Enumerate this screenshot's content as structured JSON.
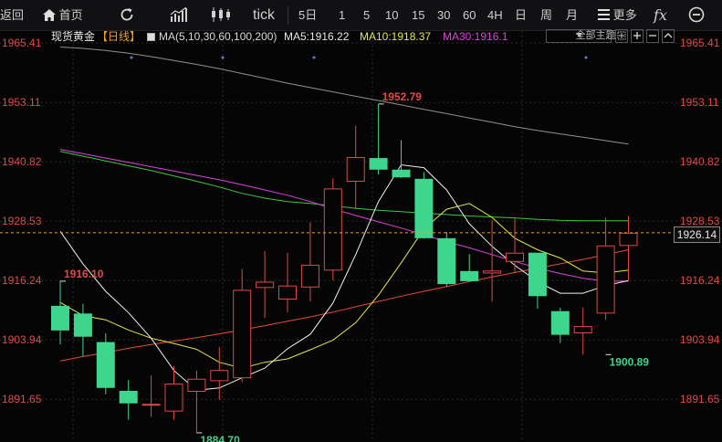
{
  "toolbar": {
    "back_label": "返回",
    "home_label": "首页",
    "refresh_icon": "refresh-icon",
    "indicator_icon": "indicator-icon",
    "candle_icon": "candlestick-icon",
    "tick_label": "tick",
    "periods": [
      "5日",
      "1",
      "5",
      "10",
      "15",
      "30",
      "60",
      "4H",
      "日",
      "周",
      "月"
    ],
    "more_label": "更多",
    "fx_label": "fx",
    "zoom_icon": "zoom-out-icon"
  },
  "infobar": {
    "symbol": "现货黄金",
    "period": "【日线】",
    "ma_params": "MA(5,10,30,60,100,200)",
    "ma5": "MA5:1916.22",
    "ma10": "MA10:1918.37",
    "ma30": "MA30:1916.1",
    "topic_label": "全部主题",
    "dropdown_icon": "chevron-down-icon",
    "tool_icons": [
      "crosshair-icon",
      "add-icon",
      "minus-icon",
      "collapse-icon"
    ]
  },
  "colors": {
    "up": "#e04848",
    "down": "#3dd68c",
    "ma5": "#f0f0f0",
    "ma10": "#e6e64a",
    "ma30": "#e040e0",
    "ma60": "#3cc83c",
    "ma100": "#e84a3a",
    "ma200": "#909090",
    "current": "#f0a020",
    "grid": "#2a2a2a"
  },
  "chart_data": {
    "type": "candlestick",
    "yticks": [
      "1965.41",
      "1953.11",
      "1940.82",
      "1928.53",
      "1916.24",
      "1903.94",
      "1891.65"
    ],
    "ylim": [
      1882.8,
      1967.9
    ],
    "current_price": "1926.14",
    "annotations": [
      {
        "text": "1916.10",
        "candle": 0,
        "value": 1916.1,
        "side": "high"
      },
      {
        "text": "1884.70",
        "candle": 6,
        "value": 1884.7,
        "side": "low"
      },
      {
        "text": "1952.79",
        "candle": 14,
        "value": 1952.79,
        "side": "high"
      },
      {
        "text": "1900.89",
        "candle": 24,
        "value": 1900.89,
        "side": "low"
      }
    ],
    "candles": [
      {
        "open": 1911.0,
        "high": 1916.1,
        "low": 1903.0,
        "close": 1905.9
      },
      {
        "open": 1909.4,
        "high": 1911.4,
        "low": 1900.5,
        "close": 1904.6
      },
      {
        "open": 1903.5,
        "high": 1905.3,
        "low": 1892.7,
        "close": 1894.0
      },
      {
        "open": 1893.4,
        "high": 1895.6,
        "low": 1887.4,
        "close": 1890.8
      },
      {
        "open": 1890.5,
        "high": 1896.6,
        "low": 1888.0,
        "close": 1890.7
      },
      {
        "open": 1889.1,
        "high": 1898.5,
        "low": 1887.4,
        "close": 1894.9
      },
      {
        "open": 1893.2,
        "high": 1897.6,
        "low": 1884.7,
        "close": 1895.9
      },
      {
        "open": 1895.4,
        "high": 1902.5,
        "low": 1891.5,
        "close": 1897.7
      },
      {
        "open": 1896.0,
        "high": 1918.6,
        "low": 1895.2,
        "close": 1914.3
      },
      {
        "open": 1914.7,
        "high": 1922.3,
        "low": 1908.5,
        "close": 1916.0
      },
      {
        "open": 1912.3,
        "high": 1922.0,
        "low": 1909.6,
        "close": 1915.2
      },
      {
        "open": 1914.8,
        "high": 1928.3,
        "low": 1911.9,
        "close": 1919.5
      },
      {
        "open": 1918.3,
        "high": 1937.4,
        "low": 1916.3,
        "close": 1935.3
      },
      {
        "open": 1936.7,
        "high": 1948.3,
        "low": 1931.0,
        "close": 1941.8
      },
      {
        "open": 1941.6,
        "high": 1952.79,
        "low": 1938.2,
        "close": 1939.2
      },
      {
        "open": 1939.2,
        "high": 1945.3,
        "low": 1937.5,
        "close": 1937.6
      },
      {
        "open": 1937.3,
        "high": 1938.7,
        "low": 1924.9,
        "close": 1925.0
      },
      {
        "open": 1925.0,
        "high": 1926.3,
        "low": 1915.0,
        "close": 1915.5
      },
      {
        "open": 1918.2,
        "high": 1921.7,
        "low": 1916.0,
        "close": 1916.1
      },
      {
        "open": 1917.7,
        "high": 1928.8,
        "low": 1911.9,
        "close": 1918.3
      },
      {
        "open": 1920.1,
        "high": 1929.1,
        "low": 1917.8,
        "close": 1922.0
      },
      {
        "open": 1922.0,
        "high": 1920.0,
        "low": 1910.4,
        "close": 1913.0
      },
      {
        "open": 1909.9,
        "high": 1910.6,
        "low": 1903.3,
        "close": 1905.0
      },
      {
        "open": 1905.3,
        "high": 1910.6,
        "low": 1900.89,
        "close": 1906.8
      },
      {
        "open": 1909.4,
        "high": 1929.3,
        "low": 1908.1,
        "close": 1923.5
      },
      {
        "open": 1923.4,
        "high": 1929.6,
        "low": 1916.3,
        "close": 1926.14
      }
    ],
    "ma5": [
      1926.4,
      1919.7,
      1914.0,
      1909.6,
      1904.3,
      1897.6,
      1893.5,
      1894.0,
      1896.1,
      1898.1,
      1902.1,
      1905.1,
      1911.6,
      1921.6,
      1932.6,
      1940.2,
      1939.6,
      1935.0,
      1928.0,
      1923.3,
      1919.4,
      1916.0,
      1913.6,
      1913.6,
      1915.2,
      1916.22
    ],
    "ma10": [
      1911.7,
      1909.0,
      1908.1,
      1906.0,
      1904.3,
      1903.2,
      1902.0,
      1899.3,
      1898.1,
      1899.3,
      1900.0,
      1901.9,
      1903.9,
      1907.5,
      1913.2,
      1919.9,
      1926.9,
      1931.0,
      1932.2,
      1929.3,
      1925.0,
      1922.6,
      1920.9,
      1918.2,
      1917.8,
      1918.37
    ],
    "ma30": [
      1943.4,
      1942.5,
      1941.6,
      1940.7,
      1939.8,
      1938.9,
      1938.0,
      1937.1,
      1936.1,
      1935.0,
      1933.9,
      1932.6,
      1931.1,
      1929.7,
      1928.4,
      1927.1,
      1925.7,
      1924.3,
      1923.0,
      1921.6,
      1920.2,
      1918.8,
      1917.7,
      1916.7,
      1916.1,
      1916.1
    ],
    "ma60": [
      1943.0,
      1942.0,
      1941.0,
      1940.0,
      1939.0,
      1937.9,
      1936.8,
      1935.6,
      1934.3,
      1933.3,
      1932.6,
      1932.2,
      1931.7,
      1931.2,
      1930.8,
      1930.5,
      1930.2,
      1929.9,
      1929.6,
      1929.4,
      1929.2,
      1928.9,
      1928.7,
      1928.6,
      1928.6,
      1928.6
    ],
    "ma100": [
      1899.6,
      1900.5,
      1901.3,
      1902.2,
      1903.0,
      1903.7,
      1904.4,
      1905.2,
      1906.0,
      1906.9,
      1907.8,
      1908.7,
      1909.7,
      1910.8,
      1911.9,
      1913.0,
      1914.0,
      1915.0,
      1916.0,
      1917.0,
      1917.9,
      1918.8,
      1919.7,
      1920.6,
      1921.6,
      1922.6
    ],
    "ma200": [
      1964.6,
      1964.3,
      1963.9,
      1963.3,
      1962.6,
      1961.8,
      1961.0,
      1960.1,
      1959.1,
      1958.1,
      1957.1,
      1956.2,
      1955.3,
      1954.4,
      1953.5,
      1952.6,
      1951.7,
      1950.8,
      1949.9,
      1949.0,
      1948.1,
      1947.3,
      1946.6,
      1945.9,
      1945.2,
      1944.5
    ]
  }
}
